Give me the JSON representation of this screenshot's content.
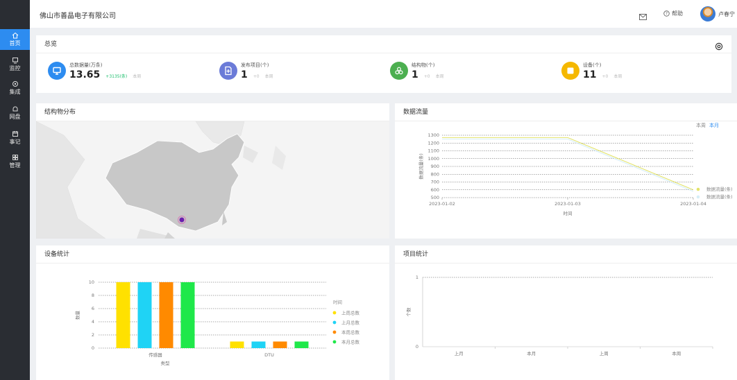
{
  "header": {
    "company": "佛山市善晶电子有限公司",
    "help": "帮助",
    "user": "卢春宁"
  },
  "sidebar": {
    "items": [
      {
        "label": "首页",
        "icon": "home-icon",
        "active": true
      },
      {
        "label": "监控",
        "icon": "monitor-icon",
        "active": false
      },
      {
        "label": "集成",
        "icon": "integration-icon",
        "active": false
      },
      {
        "label": "网盘",
        "icon": "drive-icon",
        "active": false
      },
      {
        "label": "事记",
        "icon": "calendar-icon",
        "active": false
      },
      {
        "label": "管理",
        "icon": "grid-icon",
        "active": false
      }
    ]
  },
  "overview": {
    "title": "总览",
    "stats": [
      {
        "label": "总数据量(万条)",
        "value": "13.65",
        "delta": "+3135(条)",
        "period": "本周",
        "color": "#2d8cf0",
        "icon": "monitor-icon"
      },
      {
        "label": "发布项目(个)",
        "value": "1",
        "delta": "+0",
        "period": "本周",
        "color": "#6b7bd8",
        "icon": "add-doc-icon"
      },
      {
        "label": "结构物(个)",
        "value": "1",
        "delta": "+0",
        "period": "本周",
        "color": "#4caf50",
        "icon": "structure-icon"
      },
      {
        "label": "设备(个)",
        "value": "11",
        "delta": "+0",
        "period": "本周",
        "color": "#f5b800",
        "icon": "device-icon"
      }
    ]
  },
  "map_card": {
    "title": "结构物分布"
  },
  "flow_card": {
    "title": "数据流量",
    "toggle": [
      "本周",
      "本月"
    ]
  },
  "device_card": {
    "title": "设备统计"
  },
  "project_card": {
    "title": "项目统计"
  },
  "chart_data": [
    {
      "type": "line",
      "title": "数据流量",
      "x": [
        "2023-01-02",
        "2023-01-03",
        "2023-01-04"
      ],
      "xlabel": "时间",
      "ylabel": "数据流量(条)",
      "ylim": [
        500,
        1300
      ],
      "yticks": [
        1300,
        1200,
        1100,
        1000,
        900,
        800,
        700,
        600,
        500
      ],
      "series": [
        {
          "name": "数据流量(条)",
          "values": [
            1270,
            1270,
            600
          ],
          "color": "#e3e36a"
        },
        {
          "name": "数据流量(条)",
          "values": [
            1250,
            1250,
            580
          ],
          "color": "#d6eef7"
        }
      ],
      "grid": true,
      "legend": "right"
    },
    {
      "type": "bar",
      "title": "设备统计",
      "categories": [
        "传感器",
        "DTU"
      ],
      "xlabel": "类型",
      "ylabel": "数量",
      "ylim": [
        0,
        10
      ],
      "yticks": [
        10,
        8,
        6,
        4,
        2,
        0
      ],
      "legend_title": "时间",
      "series": [
        {
          "name": "上周总数",
          "values": [
            10,
            1
          ],
          "color": "#ffe100"
        },
        {
          "name": "上月总数",
          "values": [
            10,
            1
          ],
          "color": "#1fd3f5"
        },
        {
          "name": "本周总数",
          "values": [
            10,
            1
          ],
          "color": "#ff8a00"
        },
        {
          "name": "本月总数",
          "values": [
            10,
            1
          ],
          "color": "#1fe84a"
        }
      ],
      "legend": "right"
    },
    {
      "type": "line",
      "title": "项目统计",
      "x": [
        "上月",
        "本月",
        "上周",
        "本周"
      ],
      "ylabel": "个数",
      "yticks": [
        1,
        0
      ],
      "ylim": [
        0,
        1
      ],
      "series": []
    }
  ]
}
